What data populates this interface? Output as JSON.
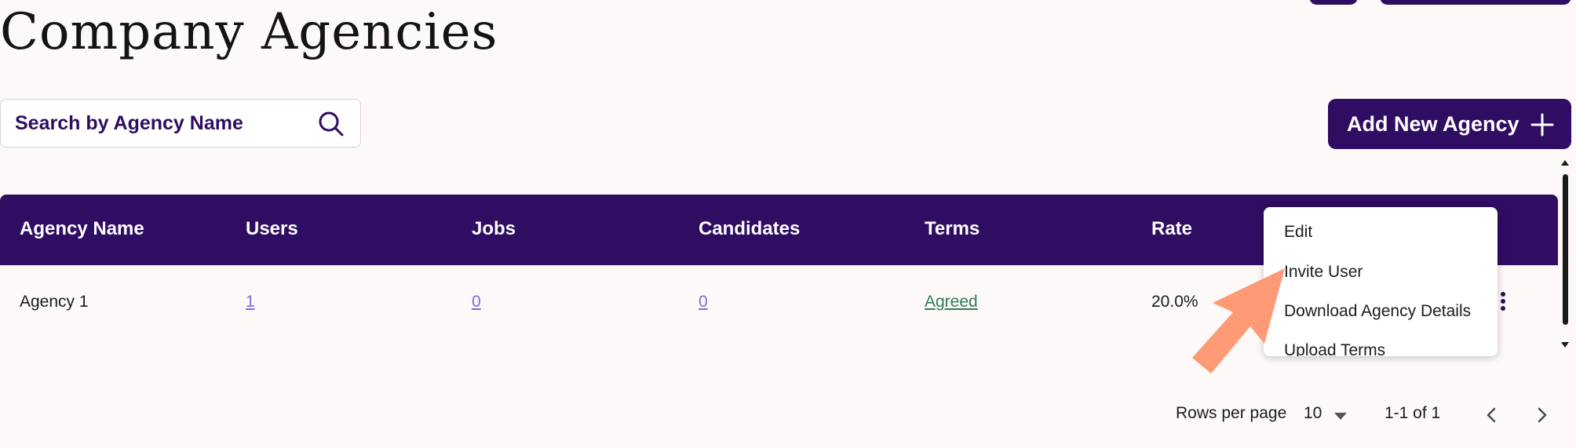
{
  "page": {
    "title": "Company Agencies"
  },
  "search": {
    "placeholder": "Search by Agency Name",
    "value": ""
  },
  "toolbar": {
    "add_label": "Add New Agency"
  },
  "table": {
    "headers": [
      "Agency Name",
      "Users",
      "Jobs",
      "Candidates",
      "Terms",
      "Rate"
    ],
    "rows": [
      {
        "agency_name": "Agency 1",
        "users": "1",
        "jobs": "0",
        "candidates": "0",
        "terms": "Agreed",
        "rate": "20.0%"
      }
    ]
  },
  "row_menu": {
    "items": [
      "Edit",
      "Invite User",
      "Download Agency Details",
      "Upload Terms"
    ]
  },
  "pagination": {
    "rows_per_page_label": "Rows per page",
    "rows_per_page_value": "10",
    "range": "1-1 of 1"
  },
  "colors": {
    "brand": "#2f0d63",
    "link": "#7c6ce0",
    "terms_link": "#2e7d4f",
    "pointer": "#ff9a76"
  },
  "icons": [
    "search-icon",
    "plus-icon",
    "kebab-menu-icon",
    "chevron-down-icon",
    "chevron-left-icon",
    "chevron-right-icon",
    "pointer-arrow-icon"
  ]
}
